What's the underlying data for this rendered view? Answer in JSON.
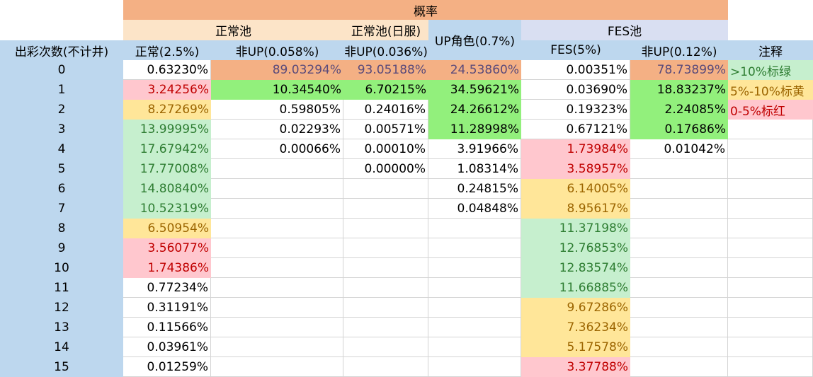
{
  "header": {
    "top": "概率",
    "group_normal": "正常池",
    "group_normal_jp": "正常池(日服)",
    "group_fes": "FES池",
    "up_role": "UP角色(0.7%)"
  },
  "columns": {
    "count": "出彩次数(不计井)",
    "normal": "正常(2.5%)",
    "non_up_1": "非UP(0.058%)",
    "non_up_2": "非UP(0.036%)",
    "fes": "FES(5%)",
    "non_up_3": "非UP(0.12%)",
    "note": "注释"
  },
  "rows": [
    {
      "n": "0",
      "normal": "0.63230%",
      "nu1": "89.03294%",
      "nu2": "93.05188%",
      "up": "24.53860%",
      "fes": "0.00351%",
      "nu3": "78.73899%"
    },
    {
      "n": "1",
      "normal": "3.24256%",
      "nu1": "10.34540%",
      "nu2": "6.70215%",
      "up": "34.59621%",
      "fes": "0.03690%",
      "nu3": "18.83237%"
    },
    {
      "n": "2",
      "normal": "8.27269%",
      "nu1": "0.59805%",
      "nu2": "0.24016%",
      "up": "24.26612%",
      "fes": "0.19323%",
      "nu3": "2.24085%"
    },
    {
      "n": "3",
      "normal": "13.99995%",
      "nu1": "0.02293%",
      "nu2": "0.00571%",
      "up": "11.28998%",
      "fes": "0.67121%",
      "nu3": "0.17686%"
    },
    {
      "n": "4",
      "normal": "17.67942%",
      "nu1": "0.00066%",
      "nu2": "0.00010%",
      "up": "3.91966%",
      "fes": "1.73984%",
      "nu3": "0.01042%"
    },
    {
      "n": "5",
      "normal": "17.77008%",
      "nu1": "",
      "nu2": "0.00000%",
      "up": "1.08314%",
      "fes": "3.58957%",
      "nu3": ""
    },
    {
      "n": "6",
      "normal": "14.80840%",
      "nu1": "",
      "nu2": "",
      "up": "0.24815%",
      "fes": "6.14005%",
      "nu3": ""
    },
    {
      "n": "7",
      "normal": "10.52319%",
      "nu1": "",
      "nu2": "",
      "up": "0.04848%",
      "fes": "8.95617%",
      "nu3": ""
    },
    {
      "n": "8",
      "normal": "6.50954%",
      "nu1": "",
      "nu2": "",
      "up": "",
      "fes": "11.37198%",
      "nu3": ""
    },
    {
      "n": "9",
      "normal": "3.56077%",
      "nu1": "",
      "nu2": "",
      "up": "",
      "fes": "12.76853%",
      "nu3": ""
    },
    {
      "n": "10",
      "normal": "1.74386%",
      "nu1": "",
      "nu2": "",
      "up": "",
      "fes": "12.83574%",
      "nu3": ""
    },
    {
      "n": "11",
      "normal": "0.77234%",
      "nu1": "",
      "nu2": "",
      "up": "",
      "fes": "11.66885%",
      "nu3": ""
    },
    {
      "n": "12",
      "normal": "0.31191%",
      "nu1": "",
      "nu2": "",
      "up": "",
      "fes": "9.67286%",
      "nu3": ""
    },
    {
      "n": "13",
      "normal": "0.11566%",
      "nu1": "",
      "nu2": "",
      "up": "",
      "fes": "7.36234%",
      "nu3": ""
    },
    {
      "n": "14",
      "normal": "0.03961%",
      "nu1": "",
      "nu2": "",
      "up": "",
      "fes": "5.17578%",
      "nu3": ""
    },
    {
      "n": "15",
      "normal": "0.01259%",
      "nu1": "",
      "nu2": "",
      "up": "",
      "fes": "3.37788%",
      "nu3": ""
    }
  ],
  "notes": [
    ">10%标绿",
    "5%-10%标黄",
    "0-5%标红"
  ],
  "colors": {
    "orange": "#f4b084",
    "cream": "#fce4c8",
    "lavender": "#d9dff2",
    "blue": "#bdd7ee",
    "green": "#c6efce",
    "bright_green": "#92f07c",
    "yellow": "#ffe699",
    "red": "#ffc7ce"
  }
}
